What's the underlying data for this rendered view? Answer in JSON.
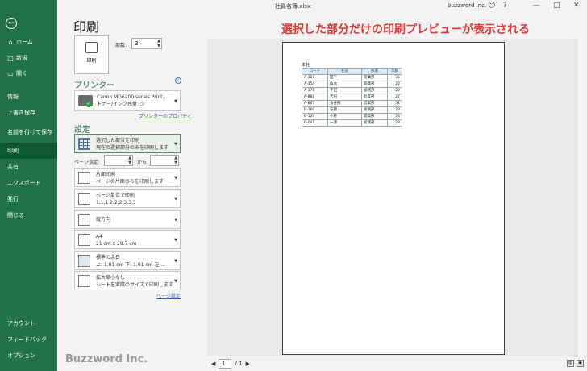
{
  "window": {
    "file_name": "社員名簿.xlsx",
    "brand": "buzzword Inc."
  },
  "sidebar": {
    "back_label": "←",
    "items": [
      {
        "label": "ホーム",
        "icon": "⌂"
      },
      {
        "label": "新規",
        "icon": "□"
      },
      {
        "label": "開く",
        "icon": "▭"
      },
      {
        "label": "情報",
        "icon": ""
      },
      {
        "label": "上書き保存",
        "icon": ""
      },
      {
        "label": "名前を付けて保存",
        "icon": ""
      },
      {
        "label": "印刷",
        "icon": ""
      },
      {
        "label": "共有",
        "icon": ""
      },
      {
        "label": "エクスポート",
        "icon": ""
      },
      {
        "label": "発行",
        "icon": ""
      },
      {
        "label": "閉じる",
        "icon": ""
      },
      {
        "label": "アカウント",
        "icon": ""
      },
      {
        "label": "フィードバック",
        "icon": ""
      },
      {
        "label": "オプション",
        "icon": ""
      }
    ],
    "active": "印刷"
  },
  "page": {
    "title": "印刷",
    "annotation": "選択した部分だけの印刷プレビューが表示される",
    "print_button": "印刷",
    "copies_label": "部数:",
    "copies_value": "3",
    "printer_heading": "プリンター",
    "printer_name": "Canon MG6200 series Print...",
    "printer_status": "トナー/インク残量: 少",
    "printer_props": "プリンターのプロパティ",
    "settings_heading": "設定",
    "page_setup_link": "ページ設定",
    "page_range_label": "ページ指定:",
    "page_range_to": "から",
    "options": [
      {
        "line1": "選択した部分を印刷",
        "line2": "現在の選択部分のみを印刷します"
      },
      {
        "line1": "片面印刷",
        "line2": "ページの片面のみを印刷します"
      },
      {
        "line1": "ページ単位で印刷",
        "line2": "1,1,1   2,2,2   3,3,3"
      },
      {
        "line1": "縦方向",
        "line2": ""
      },
      {
        "line1": "A4",
        "line2": "21 cm x 29.7 cm"
      },
      {
        "line1": "標準の余白",
        "line2": "上: 1.91 cm 下: 1.91 cm 左:..."
      },
      {
        "line1": "拡大縮小なし",
        "line2": "シートを実際のサイズで印刷します"
      }
    ]
  },
  "preview": {
    "sheet_label": "本社",
    "headers": [
      "コード",
      "名前",
      "部署",
      "年齢"
    ],
    "rows": [
      [
        "A-351",
        "田下",
        "営業部",
        "35"
      ],
      [
        "A-354",
        "山本",
        "開発部",
        "22"
      ],
      [
        "A-175",
        "平田",
        "総務部",
        "29"
      ],
      [
        "A-888",
        "吉田",
        "品質部",
        "27"
      ],
      [
        "A-867",
        "長谷部",
        "営業部",
        "31"
      ],
      [
        "B-166",
        "安藤",
        "総務部",
        "29"
      ],
      [
        "B-129",
        "小野",
        "開発部",
        "24"
      ],
      [
        "B-041",
        "一瀬",
        "総務部",
        "28"
      ]
    ],
    "current_page": "1",
    "total_pages": "/ 1"
  },
  "watermark": "Buzzword Inc."
}
